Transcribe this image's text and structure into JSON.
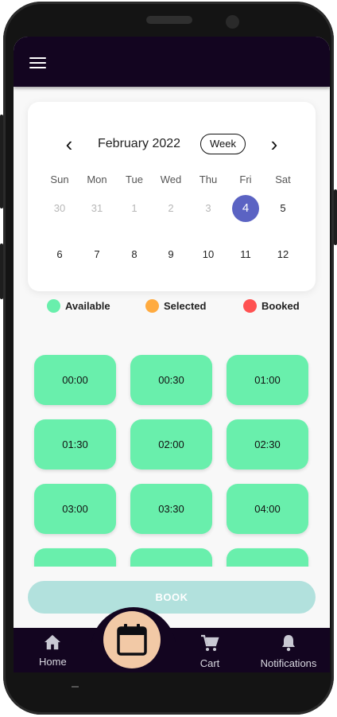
{
  "calendar": {
    "month_label": "February 2022",
    "view_toggle": "Week",
    "weekdays": [
      "Sun",
      "Mon",
      "Tue",
      "Wed",
      "Thu",
      "Fri",
      "Sat"
    ],
    "week1": [
      "30",
      "31",
      "1",
      "2",
      "3",
      "4",
      "5"
    ],
    "week2": [
      "6",
      "7",
      "8",
      "9",
      "10",
      "11",
      "12"
    ],
    "selected_day": "4"
  },
  "legend": {
    "available": {
      "label": "Available",
      "color": "#69efac"
    },
    "selected": {
      "label": "Selected",
      "color": "#ffab40"
    },
    "booked": {
      "label": "Booked",
      "color": "#ff5252"
    }
  },
  "slots": [
    "00:00",
    "00:30",
    "01:00",
    "01:30",
    "02:00",
    "02:30",
    "03:00",
    "03:30",
    "04:00",
    "",
    "",
    ""
  ],
  "book_button": "BOOK",
  "bottom_nav": {
    "home": {
      "label": "Home",
      "icon": "home-icon"
    },
    "calendar": {
      "icon": "calendar-icon"
    },
    "cart": {
      "label": "Cart",
      "icon": "cart-icon"
    },
    "notifications": {
      "label": "Notifications",
      "icon": "bell-icon"
    }
  },
  "colors": {
    "app_bar": "#130520",
    "selected_day": "#5b63c3",
    "available_slot": "#69efac",
    "book_button": "#b2e1dd",
    "fab": "#f2c9a6"
  }
}
